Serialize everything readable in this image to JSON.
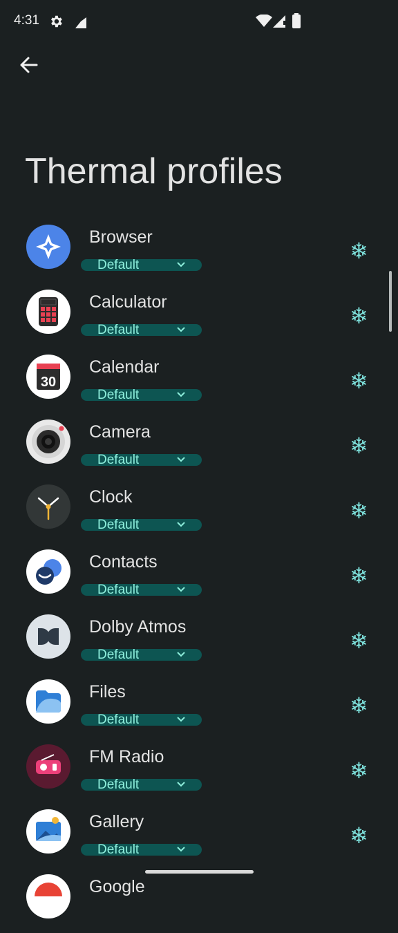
{
  "status": {
    "time": "4:31",
    "icons": [
      "gear-icon",
      "signal-partial-icon",
      "wifi-icon",
      "cellular-icon",
      "battery-icon"
    ]
  },
  "nav": {
    "back_icon": "arrow-left-icon"
  },
  "page": {
    "title": "Thermal profiles"
  },
  "colors": {
    "background": "#1b2021",
    "accent_pill": "#0d5552",
    "accent_text": "#8ff0dd",
    "snowflake": "#7ee1dc"
  },
  "apps": [
    {
      "name": "Browser",
      "profile": "Default",
      "icon": "browser-icon",
      "mode_icon": "snowflake-icon"
    },
    {
      "name": "Calculator",
      "profile": "Default",
      "icon": "calculator-icon",
      "mode_icon": "snowflake-icon"
    },
    {
      "name": "Calendar",
      "profile": "Default",
      "icon": "calendar-icon",
      "icon_text": "30",
      "mode_icon": "snowflake-icon"
    },
    {
      "name": "Camera",
      "profile": "Default",
      "icon": "camera-icon",
      "mode_icon": "snowflake-icon"
    },
    {
      "name": "Clock",
      "profile": "Default",
      "icon": "clock-icon",
      "mode_icon": "snowflake-icon"
    },
    {
      "name": "Contacts",
      "profile": "Default",
      "icon": "contacts-icon",
      "mode_icon": "snowflake-icon"
    },
    {
      "name": "Dolby Atmos",
      "profile": "Default",
      "icon": "dolby-icon",
      "mode_icon": "snowflake-icon"
    },
    {
      "name": "Files",
      "profile": "Default",
      "icon": "files-icon",
      "mode_icon": "snowflake-icon"
    },
    {
      "name": "FM Radio",
      "profile": "Default",
      "icon": "radio-icon",
      "mode_icon": "snowflake-icon"
    },
    {
      "name": "Gallery",
      "profile": "Default",
      "icon": "gallery-icon",
      "mode_icon": "snowflake-icon"
    },
    {
      "name": "Google",
      "icon": "google-icon"
    }
  ]
}
